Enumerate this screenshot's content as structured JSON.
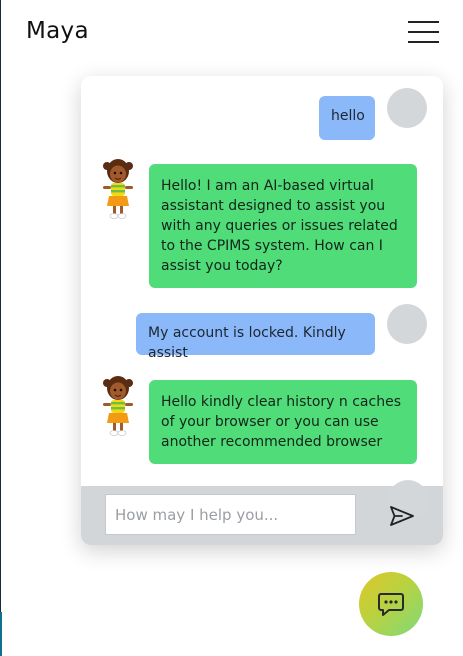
{
  "app": {
    "brand": "Maya"
  },
  "header": {
    "menu_icon": "hamburger-menu-icon"
  },
  "chat": {
    "messages": [
      {
        "sender": "user",
        "text": "hello"
      },
      {
        "sender": "bot",
        "text": "Hello! I am an AI-based virtual assistant designed to assist you with any queries or issues related to the CPIMS system. How can I assist you today?"
      },
      {
        "sender": "user",
        "text": "My account is locked. Kindly assist"
      },
      {
        "sender": "bot",
        "text": "Hello kindly clear history n caches of your browser or you can use another recommended browser"
      }
    ],
    "input": {
      "value": "",
      "placeholder": "How may I help you..."
    },
    "send_icon": "send-icon",
    "launcher_icon": "chat-bubble-icon"
  },
  "colors": {
    "user_bubble": "#8ab8f9",
    "bot_bubble": "#4fdc79",
    "avatar_placeholder": "#d4d7da",
    "input_bar": "#d3d6d9",
    "launcher_gradient_start": "#e0c52a",
    "launcher_gradient_end": "#7fd97a"
  }
}
